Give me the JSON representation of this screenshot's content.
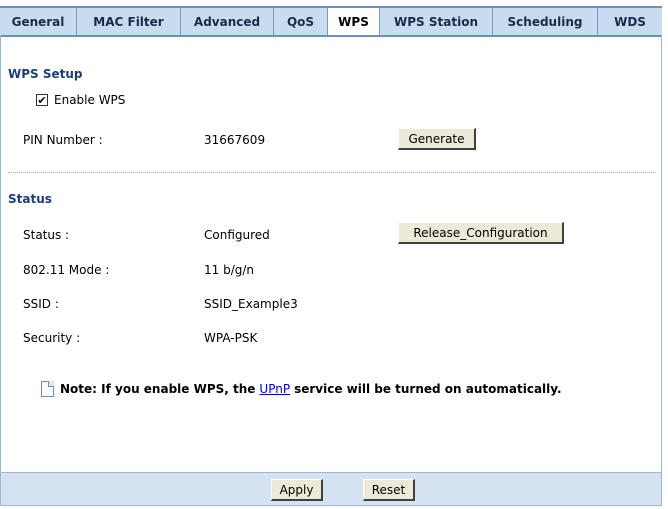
{
  "tabs": [
    "General",
    "MAC Filter",
    "Advanced",
    "QoS",
    "WPS",
    "WPS Station",
    "Scheduling",
    "WDS"
  ],
  "active_tab": "WPS",
  "wps_setup": {
    "title": "WPS Setup",
    "enable_label": "Enable WPS",
    "enable_checked": "✔",
    "pin_label": "PIN Number :",
    "pin_value": "31667609",
    "generate_label": "Generate"
  },
  "status": {
    "title": "Status",
    "status_label": "Status :",
    "status_value": "Configured",
    "release_label": "Release_Configuration",
    "mode_label": "802.11 Mode :",
    "mode_value": "11 b/g/n",
    "ssid_label": "SSID :",
    "ssid_value": "SSID_Example3",
    "security_label": "Security :",
    "security_value": "WPA-PSK"
  },
  "note": {
    "prefix": "Note: If you enable WPS, the",
    "link": "UPnP",
    "suffix": "service will be turned on automatically."
  },
  "footer": {
    "apply_label": "Apply",
    "reset_label": "Reset"
  },
  "colors": {
    "tab_bar": "#c9dbef",
    "section_title": "#1d3e75",
    "footer": "#d5e2f2"
  }
}
